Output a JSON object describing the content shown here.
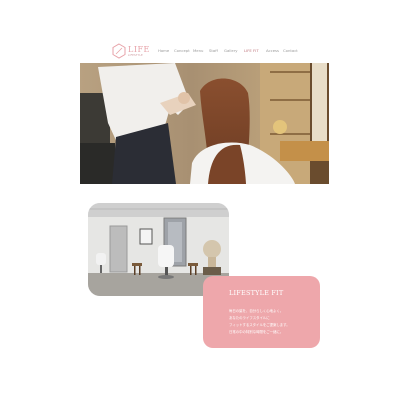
{
  "brand": {
    "logo_text": "LIFE",
    "logo_sub": "LIFESTYLE",
    "accent_color": "#e7a2a8"
  },
  "nav": {
    "items": [
      {
        "label": "Home"
      },
      {
        "label": "Concept"
      },
      {
        "label": "Menu"
      },
      {
        "label": "Staff"
      },
      {
        "label": "Gallery"
      },
      {
        "label": "LIFE FIT"
      },
      {
        "label": "Access"
      },
      {
        "label": "Contact"
      }
    ],
    "active_index": 5
  },
  "feature": {
    "title": "LIFESTYLE FIT",
    "lines": [
      "毎日の髪を、自分らしく心地よく。",
      "あなたのライフスタイルに",
      "フィットするスタイルをご提案します。",
      "日常の中の特別な時間をご一緒に。"
    ],
    "panel_color": "#eea7ab"
  }
}
